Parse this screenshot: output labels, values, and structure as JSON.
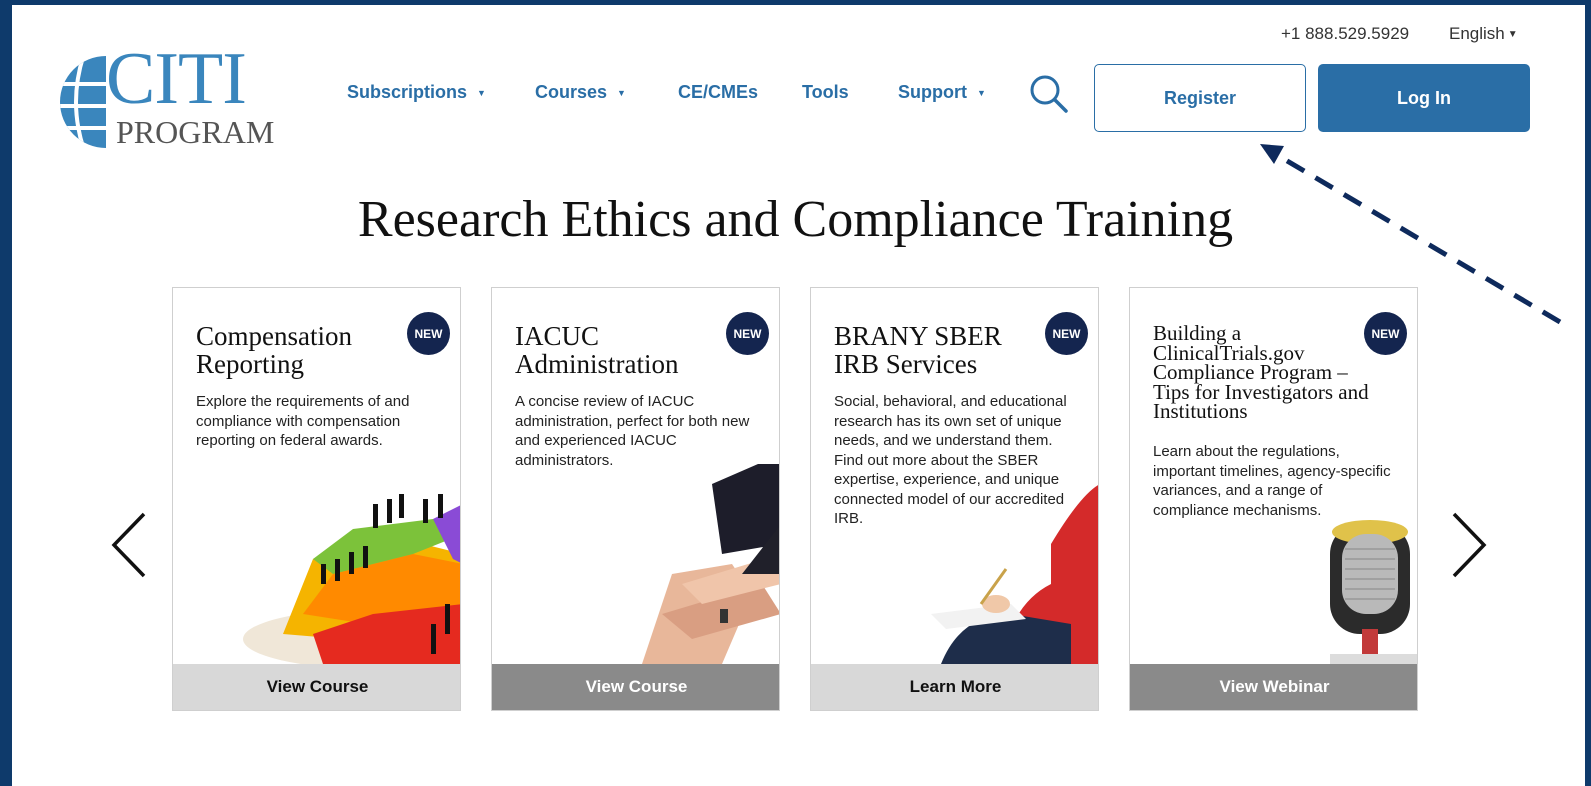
{
  "brand": {
    "logo_main": "CITI",
    "logo_sub": "PROGRAM"
  },
  "utility": {
    "phone": "+1 888.529.5929",
    "language": "English"
  },
  "nav": [
    {
      "label": "Subscriptions",
      "has_dropdown": true
    },
    {
      "label": "Courses",
      "has_dropdown": true
    },
    {
      "label": "CE/CMEs",
      "has_dropdown": false
    },
    {
      "label": "Tools",
      "has_dropdown": false
    },
    {
      "label": "Support",
      "has_dropdown": true
    }
  ],
  "actions": {
    "register_label": "Register",
    "login_label": "Log In"
  },
  "hero": {
    "title": "Research Ethics and Compliance Training"
  },
  "cards": [
    {
      "title": "Compensation Reporting",
      "badge": "NEW",
      "description": "Explore the requirements of and compliance with compensation reporting on federal awards.",
      "button": "View Course",
      "image": "pie-chart-business-people"
    },
    {
      "title": "IACUC Administration",
      "badge": "NEW",
      "description": "A concise review of IACUC administration, perfect for both new and experienced IACUC administrators.",
      "button": "View Course",
      "image": "stacked-hands"
    },
    {
      "title": "BRANY SBER IRB Services",
      "badge": "NEW",
      "description": "Social, behavioral, and educational research has its own set of unique needs, and we understand them. Find out more about the SBER expertise, experience, and unique connected model of our accredited IRB.",
      "button": "Learn More",
      "image": "person-writing"
    },
    {
      "title": "Building a ClinicalTrials.gov Compliance Program – Tips for Investigators and Institutions",
      "badge": "NEW",
      "description": "Learn about the regulations, important timelines, agency-specific variances, and a range of compliance mechanisms.",
      "button": "View Webinar",
      "image": "studio-microphone"
    }
  ],
  "colors": {
    "brand_blue": "#2a6ea6",
    "logo_blue": "#3a86bd",
    "badge_navy": "#14254f",
    "annotation": "#0e2a5c"
  }
}
